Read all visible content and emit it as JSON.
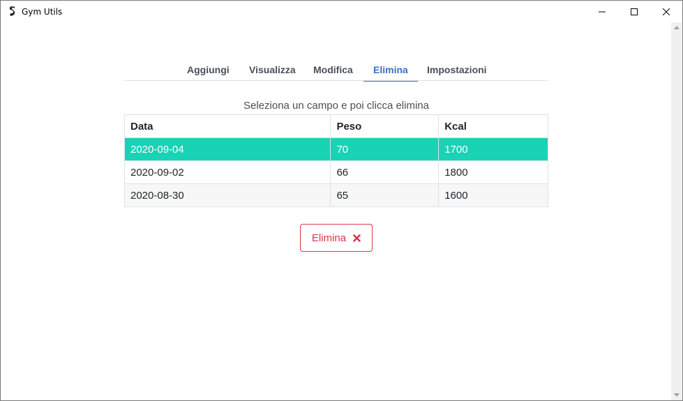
{
  "window": {
    "title": "Gym Utils"
  },
  "tabs": [
    {
      "label": "Aggiungi",
      "active": false
    },
    {
      "label": "Visualizza",
      "active": false
    },
    {
      "label": "Modifica",
      "active": false
    },
    {
      "label": "Elimina",
      "active": true
    },
    {
      "label": "Impostazioni",
      "active": false
    }
  ],
  "caption": "Seleziona un campo e poi clicca elimina",
  "table": {
    "headers": [
      "Data",
      "Peso",
      "Kcal"
    ],
    "rows": [
      [
        "2020-09-04",
        "70",
        "1700"
      ],
      [
        "2020-09-02",
        "66",
        "1800"
      ],
      [
        "2020-08-30",
        "65",
        "1600"
      ]
    ],
    "selected_row": 0
  },
  "delete_button": {
    "label": "Elimina",
    "icon": "close-icon"
  },
  "colors": {
    "accent": "#3f6fbf",
    "selected_row": "#1ad2b4",
    "danger": "#dc3545"
  }
}
